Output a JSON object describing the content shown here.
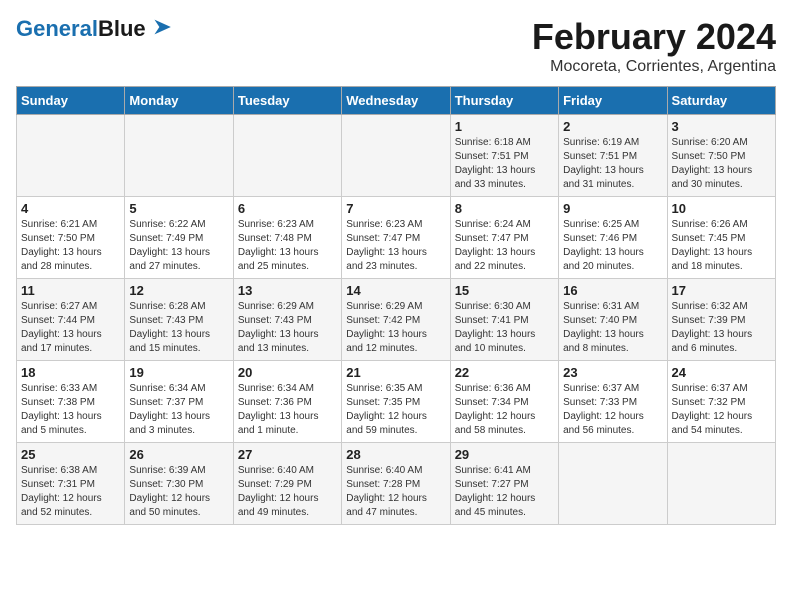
{
  "logo": {
    "part1": "General",
    "part2": "Blue"
  },
  "title": "February 2024",
  "subtitle": "Mocoreta, Corrientes, Argentina",
  "days_of_week": [
    "Sunday",
    "Monday",
    "Tuesday",
    "Wednesday",
    "Thursday",
    "Friday",
    "Saturday"
  ],
  "weeks": [
    [
      {
        "day": "",
        "info": ""
      },
      {
        "day": "",
        "info": ""
      },
      {
        "day": "",
        "info": ""
      },
      {
        "day": "",
        "info": ""
      },
      {
        "day": "1",
        "info": "Sunrise: 6:18 AM\nSunset: 7:51 PM\nDaylight: 13 hours\nand 33 minutes."
      },
      {
        "day": "2",
        "info": "Sunrise: 6:19 AM\nSunset: 7:51 PM\nDaylight: 13 hours\nand 31 minutes."
      },
      {
        "day": "3",
        "info": "Sunrise: 6:20 AM\nSunset: 7:50 PM\nDaylight: 13 hours\nand 30 minutes."
      }
    ],
    [
      {
        "day": "4",
        "info": "Sunrise: 6:21 AM\nSunset: 7:50 PM\nDaylight: 13 hours\nand 28 minutes."
      },
      {
        "day": "5",
        "info": "Sunrise: 6:22 AM\nSunset: 7:49 PM\nDaylight: 13 hours\nand 27 minutes."
      },
      {
        "day": "6",
        "info": "Sunrise: 6:23 AM\nSunset: 7:48 PM\nDaylight: 13 hours\nand 25 minutes."
      },
      {
        "day": "7",
        "info": "Sunrise: 6:23 AM\nSunset: 7:47 PM\nDaylight: 13 hours\nand 23 minutes."
      },
      {
        "day": "8",
        "info": "Sunrise: 6:24 AM\nSunset: 7:47 PM\nDaylight: 13 hours\nand 22 minutes."
      },
      {
        "day": "9",
        "info": "Sunrise: 6:25 AM\nSunset: 7:46 PM\nDaylight: 13 hours\nand 20 minutes."
      },
      {
        "day": "10",
        "info": "Sunrise: 6:26 AM\nSunset: 7:45 PM\nDaylight: 13 hours\nand 18 minutes."
      }
    ],
    [
      {
        "day": "11",
        "info": "Sunrise: 6:27 AM\nSunset: 7:44 PM\nDaylight: 13 hours\nand 17 minutes."
      },
      {
        "day": "12",
        "info": "Sunrise: 6:28 AM\nSunset: 7:43 PM\nDaylight: 13 hours\nand 15 minutes."
      },
      {
        "day": "13",
        "info": "Sunrise: 6:29 AM\nSunset: 7:43 PM\nDaylight: 13 hours\nand 13 minutes."
      },
      {
        "day": "14",
        "info": "Sunrise: 6:29 AM\nSunset: 7:42 PM\nDaylight: 13 hours\nand 12 minutes."
      },
      {
        "day": "15",
        "info": "Sunrise: 6:30 AM\nSunset: 7:41 PM\nDaylight: 13 hours\nand 10 minutes."
      },
      {
        "day": "16",
        "info": "Sunrise: 6:31 AM\nSunset: 7:40 PM\nDaylight: 13 hours\nand 8 minutes."
      },
      {
        "day": "17",
        "info": "Sunrise: 6:32 AM\nSunset: 7:39 PM\nDaylight: 13 hours\nand 6 minutes."
      }
    ],
    [
      {
        "day": "18",
        "info": "Sunrise: 6:33 AM\nSunset: 7:38 PM\nDaylight: 13 hours\nand 5 minutes."
      },
      {
        "day": "19",
        "info": "Sunrise: 6:34 AM\nSunset: 7:37 PM\nDaylight: 13 hours\nand 3 minutes."
      },
      {
        "day": "20",
        "info": "Sunrise: 6:34 AM\nSunset: 7:36 PM\nDaylight: 13 hours\nand 1 minute."
      },
      {
        "day": "21",
        "info": "Sunrise: 6:35 AM\nSunset: 7:35 PM\nDaylight: 12 hours\nand 59 minutes."
      },
      {
        "day": "22",
        "info": "Sunrise: 6:36 AM\nSunset: 7:34 PM\nDaylight: 12 hours\nand 58 minutes."
      },
      {
        "day": "23",
        "info": "Sunrise: 6:37 AM\nSunset: 7:33 PM\nDaylight: 12 hours\nand 56 minutes."
      },
      {
        "day": "24",
        "info": "Sunrise: 6:37 AM\nSunset: 7:32 PM\nDaylight: 12 hours\nand 54 minutes."
      }
    ],
    [
      {
        "day": "25",
        "info": "Sunrise: 6:38 AM\nSunset: 7:31 PM\nDaylight: 12 hours\nand 52 minutes."
      },
      {
        "day": "26",
        "info": "Sunrise: 6:39 AM\nSunset: 7:30 PM\nDaylight: 12 hours\nand 50 minutes."
      },
      {
        "day": "27",
        "info": "Sunrise: 6:40 AM\nSunset: 7:29 PM\nDaylight: 12 hours\nand 49 minutes."
      },
      {
        "day": "28",
        "info": "Sunrise: 6:40 AM\nSunset: 7:28 PM\nDaylight: 12 hours\nand 47 minutes."
      },
      {
        "day": "29",
        "info": "Sunrise: 6:41 AM\nSunset: 7:27 PM\nDaylight: 12 hours\nand 45 minutes."
      },
      {
        "day": "",
        "info": ""
      },
      {
        "day": "",
        "info": ""
      }
    ]
  ]
}
